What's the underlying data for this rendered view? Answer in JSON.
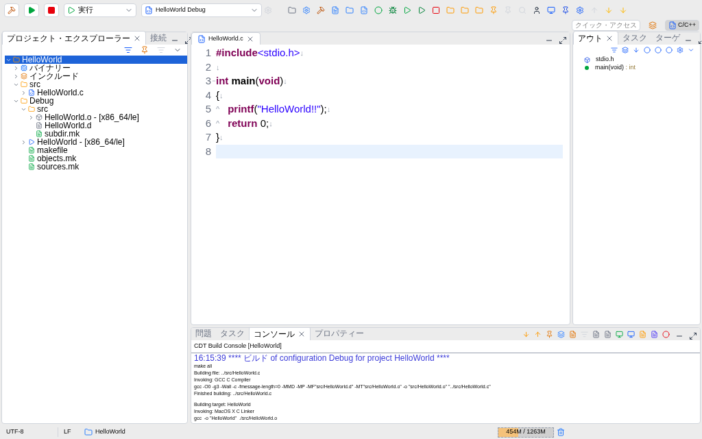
{
  "toolbar": {
    "run_mode": "実行",
    "launch_config": "HelloWorld Debug"
  },
  "quick_access": {
    "placeholder": "クイック・アクセス"
  },
  "perspective": {
    "label": "C/C++",
    "selected": true
  },
  "explorer": {
    "tabs": [
      {
        "label": "プロジェクト・エクスプローラー",
        "selected": true,
        "closable": true
      },
      {
        "label": "接続",
        "selected": false,
        "closable": false
      }
    ],
    "tree": [
      {
        "label": "HelloWorld",
        "kind": "project",
        "expanded": true,
        "selected": true,
        "children": [
          {
            "label": "バイナリー",
            "kind": "binaries",
            "expanded": false,
            "selected": false
          },
          {
            "label": "インクルード",
            "kind": "includes",
            "expanded": false,
            "selected": false
          },
          {
            "label": "src",
            "kind": "srcfolder",
            "expanded": true,
            "selected": false,
            "children": [
              {
                "label": "HelloWorld.c",
                "kind": "cfile",
                "expanded": false,
                "selected": false
              }
            ]
          },
          {
            "label": "Debug",
            "kind": "folder",
            "expanded": true,
            "selected": false,
            "children": [
              {
                "label": "src",
                "kind": "folder",
                "expanded": true,
                "selected": false,
                "children": [
                  {
                    "label": "HelloWorld.o - [x86_64/le]",
                    "kind": "object",
                    "expanded": false,
                    "selected": false
                  },
                  {
                    "label": "HelloWorld.d",
                    "kind": "textfile",
                    "selected": false
                  },
                  {
                    "label": "subdir.mk",
                    "kind": "makefile",
                    "selected": false
                  }
                ]
              },
              {
                "label": "HelloWorld - [x86_64/le]",
                "kind": "executable",
                "expanded": false,
                "selected": false
              },
              {
                "label": "makefile",
                "kind": "makefile",
                "selected": false
              },
              {
                "label": "objects.mk",
                "kind": "makefile",
                "selected": false
              },
              {
                "label": "sources.mk",
                "kind": "makefile",
                "selected": false
              }
            ]
          }
        ]
      }
    ]
  },
  "editor": {
    "tab": "HelloWorld.c",
    "lines": [
      {
        "number": "1",
        "current": false,
        "tokens": [
          {
            "text": "#include",
            "kind": "keyword"
          },
          {
            "text": "<stdio.h>",
            "kind": "string"
          },
          {
            "text": "↓",
            "kind": "mark"
          }
        ]
      },
      {
        "number": "2",
        "current": false,
        "tokens": [
          {
            "text": "↓",
            "kind": "mark"
          }
        ]
      },
      {
        "number": "3",
        "current": false,
        "folding": true,
        "tokens": [
          {
            "text": "int",
            "kind": "keyword"
          },
          {
            "text": " main",
            "kind": "bold"
          },
          {
            "text": "(",
            "kind": "plain"
          },
          {
            "text": "void",
            "kind": "keyword"
          },
          {
            "text": ")",
            "kind": "plain"
          },
          {
            "text": "↓",
            "kind": "mark"
          }
        ]
      },
      {
        "number": "4",
        "current": false,
        "tokens": [
          {
            "text": "{",
            "kind": "plain"
          },
          {
            "text": "↓",
            "kind": "mark"
          }
        ]
      },
      {
        "number": "5",
        "current": false,
        "tokens": [
          {
            "text": "^",
            "kind": "tab"
          },
          {
            "text": "printf",
            "kind": "keyword"
          },
          {
            "text": "(",
            "kind": "plain"
          },
          {
            "text": "\"HelloWorld!!\"",
            "kind": "string"
          },
          {
            "text": ");",
            "kind": "plain"
          },
          {
            "text": "↓",
            "kind": "mark"
          }
        ]
      },
      {
        "number": "6",
        "current": false,
        "tokens": [
          {
            "text": "^",
            "kind": "tab"
          },
          {
            "text": "return",
            "kind": "keyword"
          },
          {
            "text": " 0;",
            "kind": "plain"
          },
          {
            "text": "↓",
            "kind": "mark"
          }
        ]
      },
      {
        "number": "7",
        "current": false,
        "tokens": [
          {
            "text": "}",
            "kind": "plain"
          },
          {
            "text": "↓",
            "kind": "mark"
          }
        ]
      },
      {
        "number": "8",
        "current": true
      }
    ]
  },
  "outline": {
    "tabs": [
      {
        "label": "アウト",
        "selected": true,
        "closable": true
      },
      {
        "label": "タスク",
        "selected": false,
        "closable": false
      },
      {
        "label": "ターゲ",
        "selected": false,
        "closable": false
      }
    ],
    "items": [
      {
        "label": "stdio.h",
        "kind": "include"
      },
      {
        "label": "main(void)",
        "type": " : int",
        "kind": "function"
      }
    ]
  },
  "console": {
    "tabs": [
      {
        "label": "問題",
        "selected": false,
        "closable": false
      },
      {
        "label": "タスク",
        "selected": false,
        "closable": false
      },
      {
        "label": "コンソール",
        "selected": true,
        "closable": true
      },
      {
        "label": "プロパティー",
        "selected": false,
        "closable": false
      }
    ],
    "title": "CDT Build Console [HelloWorld]",
    "lines": [
      {
        "text": "16:15:39 **** ビルド of configuration Debug for project HelloWorld ****",
        "kind": "info"
      },
      {
        "text": "make all",
        "kind": "output"
      },
      {
        "text": "Building file: ../src/HelloWorld.c",
        "kind": "output"
      },
      {
        "text": "Invoking: GCC C Compiler",
        "kind": "output"
      },
      {
        "text": "gcc -O0 -g3 -Wall -c -fmessage-length=0 -MMD -MP -MF\"src/HelloWorld.d\" -MT\"src/HelloWorld.o\" -o \"src/HelloWorld.o\" \"../src/HelloWorld.c\"",
        "kind": "output"
      },
      {
        "text": "Finished building: ../src/HelloWorld.c",
        "kind": "output"
      },
      {
        "kind": "blank"
      },
      {
        "text": "Building target: HelloWorld",
        "kind": "output"
      },
      {
        "text": "Invoking: MacOS X C Linker",
        "kind": "output"
      },
      {
        "text": "gcc  -o \"HelloWorld\"  ./src/HelloWorld.o",
        "kind": "output"
      }
    ]
  },
  "status_bar": {
    "encoding": "UTF-8",
    "line_delimiter": "LF",
    "project": "HelloWorld",
    "heap": {
      "reading": "454M / 1263M",
      "level": 0.36
    }
  }
}
